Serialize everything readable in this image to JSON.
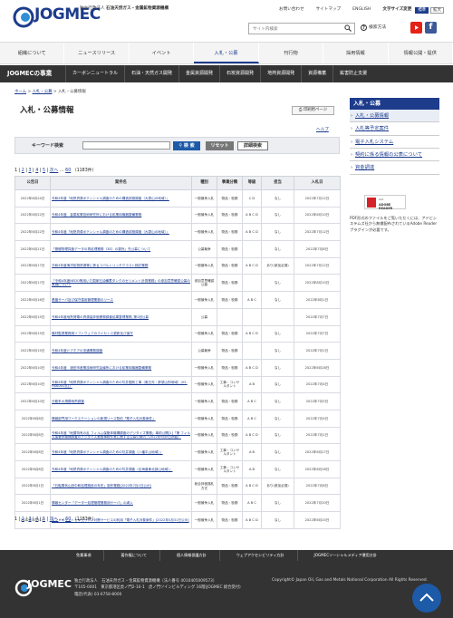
{
  "header": {
    "logo_text": "JOGMEC",
    "org_name_prefix": "独立行政法人",
    "org_name": "石油天然ガス・金属鉱物資源機構",
    "util_links": [
      "お問い合わせ",
      "サイトマップ",
      "ENGLISH"
    ],
    "font_size_label": "文字サイズ変更",
    "font_size_options": [
      "標準",
      "拡大"
    ],
    "search_placeholder": "サイト内検索",
    "help_label": "検索方法"
  },
  "main_nav": [
    "組織について",
    "ニュースリリース",
    "イベント",
    "入札・公募",
    "刊行物",
    "採用情報",
    "情報公開・提供"
  ],
  "biz_nav": {
    "head": "JOGMECの事業",
    "items": [
      "カーボンニュートラル",
      "石油・天然ガス開発",
      "金属資源開発",
      "石炭資源開発",
      "地熱資源開発",
      "資源備蓄",
      "鉱害防止支援"
    ]
  },
  "breadcrumb": [
    "ホーム",
    "入札・公募",
    "入札・公募情報"
  ],
  "page": {
    "title": "入札・公募情報",
    "print_label": "印刷用ページ",
    "help_link": "ヘルプ"
  },
  "keyword": {
    "label": "キーワード検索",
    "search_btn": "検 索",
    "reset_btn": "リセット",
    "detail_btn": "詳細検索"
  },
  "pager": {
    "pages": [
      "1",
      "2",
      "3",
      "4",
      "5"
    ],
    "next": "次へ",
    "ellipsis": "…",
    "last": "60",
    "count": "（1183件）"
  },
  "table": {
    "headers": [
      "公告日",
      "案件名",
      "種別",
      "事業分類",
      "等級",
      "担当",
      "入札日"
    ],
    "rows": [
      {
        "date": "2022年6月24日",
        "title": "令和4年度「地熱資源ポテンシャル調査のための構造試錐調査（大霧山の地域）」",
        "type": "一般競争入札",
        "category": "物品・役務",
        "grade": "C D",
        "dept": "なし",
        "bid": "2022年7月12日"
      },
      {
        "date": "2022年6月22日",
        "title": "令和4年度　金属鉱業技術研究所における鉱業用機器整備業務",
        "type": "一般競争入札",
        "category": "物品・役務",
        "grade": "A B C D",
        "dept": "なし",
        "bid": "2022年6月10日"
      },
      {
        "date": "2022年6月22日",
        "title": "令和4年度「地熱資源ポテンシャル調査のための構造試錐調査（大霧山の地域）」",
        "type": "一般競争入札",
        "category": "物品・役務",
        "grade": "A B C D",
        "dept": "なし",
        "bid": "2022年7月12日"
      },
      {
        "date": "2022年6月21日",
        "title": "「基礎物理探査データの再処理業務（3D）の委託」先公募について",
        "type": "公募競争",
        "category": "物品・役務",
        "grade": "",
        "dept": "なし",
        "bid": "2022年7月8日"
      },
      {
        "date": "2022年6月17日",
        "title": "令和4年度海洋鉱物資源等に係るコバルトリッチクラスト検討業務",
        "type": "一般競争入札",
        "category": "物品・役務",
        "grade": "A B C D",
        "dept": "あり(参加必須)",
        "bid": "2022年7月12日"
      },
      {
        "date": "2022年6月17日",
        "title": "「令和4年度NEDO等用いた国家石油備蓄タンクのセリメント計測業務」の参加意思確認公募の実施について",
        "type": "参加意思確認公募",
        "category": "物品・役務",
        "grade": "",
        "dept": "なし",
        "bid": "2022年8月10日"
      },
      {
        "date": "2022年6月16日",
        "title": "基盤サーバ及び保守運用管理業務のリース",
        "type": "一般競争入札",
        "category": "物品・役務",
        "grade": "A B C",
        "dept": "なし",
        "bid": "2022年8月1日"
      },
      {
        "date": "2022年6月15日",
        "title": "令和4年度地熱発電の資源量評価業務調査結果整理業務_第1回公募",
        "type": "公募",
        "category": "",
        "grade": "",
        "dept": "",
        "bid": "2022年7月7日"
      },
      {
        "date": "2022年6月15日",
        "title": "機材監視業務用ソフトウェアのライセンス更新及び保守",
        "type": "一般競争入札",
        "category": "物品・役務",
        "grade": "A B C D",
        "dept": "なし",
        "bid": "2022年7月7日"
      },
      {
        "date": "2022年6月15日",
        "title": "令和4年度ドアホアの流通業務調査",
        "type": "公募競争",
        "category": "物品・役務",
        "grade": "",
        "dept": "なし",
        "bid": "2022年7月1日"
      },
      {
        "date": "2022年6月10日",
        "title": "令和4年度　酒田市産業技術研究会議所における鉱業用機器整備業務",
        "type": "一般競争入札",
        "category": "物品・役務",
        "grade": "A B C D",
        "dept": "なし",
        "bid": "2022年6月28日"
      },
      {
        "date": "2022年6月10日",
        "title": "令和4年度「地熱資源ポテンシャル調査のための坑井掘削工事（奥日光・那須山別地域）(02-HSK001孔)」",
        "type": "一般競争入札",
        "category": "工事・コンサルタント",
        "grade": "A B",
        "dept": "なし",
        "bid": "2022年7月4日"
      },
      {
        "date": "2022年6月10日",
        "title": "分散系大規模地熱調査",
        "type": "一般競争入札",
        "category": "物品・役務",
        "grade": "A B C",
        "dept": "なし",
        "bid": "2022年7月5日"
      },
      {
        "date": "2022年6月8日",
        "title": "情報部門用ワークステーションの新規リース契約「電子入札対象案件」",
        "type": "一般競争入札",
        "category": "物品・役務",
        "grade": "A B C",
        "dept": "なし",
        "bid": "2022年7月4日"
      },
      {
        "date": "2022年6月8日",
        "title": "令和4年度「地層特有の乱 フィルム保管体機構調査のデジタイズ業務」事前公開[1]「第 フィルム保管体機構調査のデジタイズ業務事務作業に関する公募の案内（2022年6月8日掲載）",
        "type": "一般競争入札",
        "category": "物品・役務",
        "grade": "A B C D",
        "dept": "なし",
        "bid": "2022年7月1日"
      },
      {
        "date": "2022年6月8日",
        "title": "令和4年度「地熱資源ポテンシャル調査のための坑井調査（八幡平山地域）」",
        "type": "一般競争入札",
        "category": "工事・コンサルタント",
        "grade": "A B",
        "dept": "なし",
        "bid": "2022年6月27日"
      },
      {
        "date": "2022年6月8日",
        "title": "令和4年度「地熱資源ポテンシャル調査のための坑井調査（北海道東北部山地域）」",
        "type": "一般競争入札",
        "category": "工事・コンサルタント",
        "grade": "A B",
        "dept": "なし",
        "bid": "2022年6月28日"
      },
      {
        "date": "2022年6月1日",
        "title": "「石転電気山田中和処理施設の年史」制作業務[2022年7月1日公示]",
        "type": "総合評価落札方式",
        "category": "物品・役務",
        "grade": "A B C D",
        "dept": "あり(参加必須)",
        "bid": "2022年7月8日"
      },
      {
        "date": "2022年6月1日",
        "title": "情報センター「データー処理管理業務用サーバ」の導入",
        "type": "一般競争入札",
        "category": "物品・役務",
        "grade": "A B C",
        "dept": "なし",
        "bid": "2022年7月20日"
      },
      {
        "date": "2022年5月31日",
        "title": "エンドポイントセキュリティ対策サービスの利用「電子入札対象案件」[2022年5月31日公示]",
        "type": "一般競争入札",
        "category": "物品・役務",
        "grade": "A B C D",
        "dept": "なし",
        "bid": "2022年6月20日"
      }
    ]
  },
  "sidebar": {
    "head": "入札・公募",
    "items": [
      "入札・公募情報",
      "入札等予定案件",
      "電子入札システム",
      "契約に係る情報の公表について",
      "資金調達"
    ]
  },
  "adobe": {
    "small": "Get",
    "big": "ADOBE READER",
    "note": "PDF形式のファイルをご覧いただくには、アドビシステムズ社から無償配布されているAdobe Readerプラグインが必要です。"
  },
  "footer": {
    "links": [
      "免責事項",
      "著作権について",
      "個人情報保護方針",
      "ウェブアクセシビリティ方針",
      "JOGMECソーシャルメディア運用方針"
    ],
    "logo_text": "JOGMEC",
    "addr1": "独立行政法人　石油天然ガス・金属鉱物資源機構（法人番号 4010405009573）",
    "addr2": "〒105-0001　東京都港区虎ノ門2-10-1　虎ノ門ツインビルディング 16階(JOGMEC 総合受付)",
    "addr3": "電話(代表) 03-6758-8000",
    "copyright": "Copyright© Japan Oil, Gas and Metals National Corporation All Rights Reserved."
  }
}
